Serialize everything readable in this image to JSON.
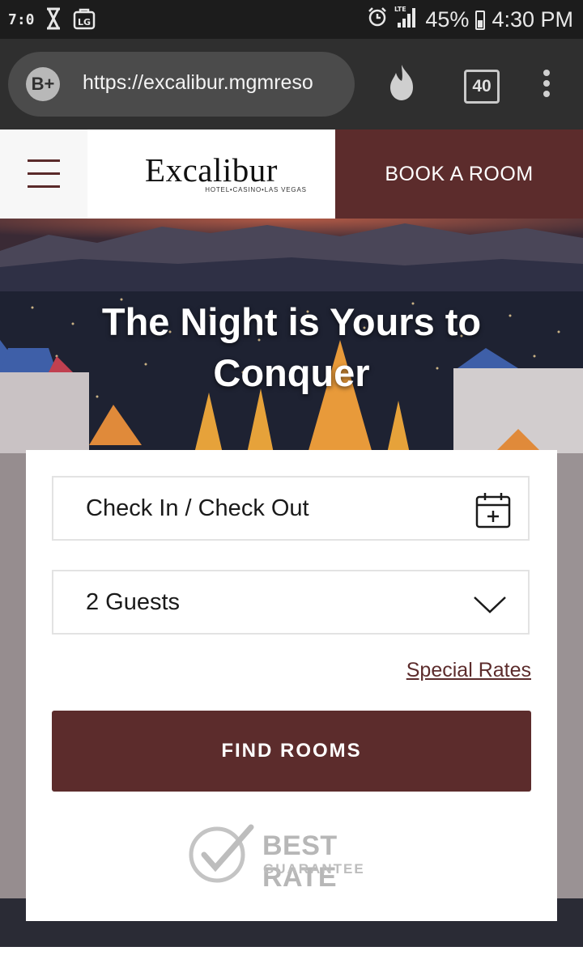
{
  "status_bar": {
    "left_icons": [
      "weather-clock-icon",
      "hourglass-icon",
      "lg-icon"
    ],
    "alarm_icon": "alarm-clock-icon",
    "network": "LTE",
    "battery": "45%",
    "time": "4:30 PM"
  },
  "browser": {
    "security_grade": "B+",
    "url": "https://excalibur.mgmreso",
    "tab_count": "40",
    "icons": [
      "flame-icon",
      "tab-counter-icon",
      "overflow-menu-icon"
    ]
  },
  "header": {
    "logo_text": "Excalibur",
    "logo_subtitle": "HOTEL•CASINO•LAS VEGAS",
    "book_label": "BOOK A ROOM",
    "colors": {
      "brand": "#5c2c2c"
    }
  },
  "hero": {
    "title": "The Night is Yours to Conquer"
  },
  "booking": {
    "dates_placeholder": "Check In / Check Out",
    "guests_value": "2 Guests",
    "special_rates_label": "Special Rates",
    "find_rooms_label": "FIND ROOMS"
  },
  "badge": {
    "title": "BEST RATE",
    "subtitle": "GUARANTEE"
  }
}
